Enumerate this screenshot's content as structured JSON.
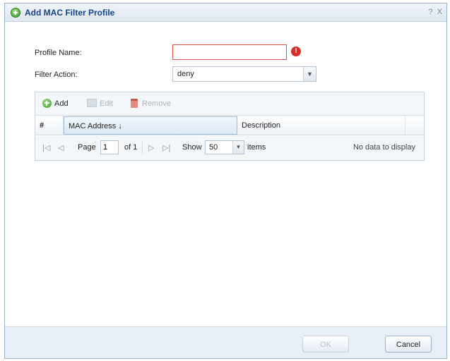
{
  "dialog": {
    "title": "Add MAC Filter Profile",
    "help_label": "?",
    "close_label": "X"
  },
  "form": {
    "profile_name_label": "Profile Name:",
    "profile_name_value": "",
    "filter_action_label": "Filter Action:",
    "filter_action_value": "deny"
  },
  "toolbar": {
    "add_label": "Add",
    "edit_label": "Edit",
    "remove_label": "Remove"
  },
  "table": {
    "columns": [
      "#",
      "MAC Address",
      "Description"
    ],
    "sort_indicator": "↓",
    "rows": []
  },
  "pager": {
    "first": "|◁",
    "prev": "◁",
    "page_label": "Page",
    "page_value": "1",
    "of_label": "of 1",
    "next": "▷",
    "last": "▷|",
    "show_label": "Show",
    "page_size": "50",
    "items_label": "items",
    "empty_text": "No data to display"
  },
  "buttons": {
    "ok_label": "OK",
    "cancel_label": "Cancel"
  },
  "colors": {
    "title_text": "#15428b",
    "error": "#d9302b",
    "add_icon": "#3a9a24"
  }
}
